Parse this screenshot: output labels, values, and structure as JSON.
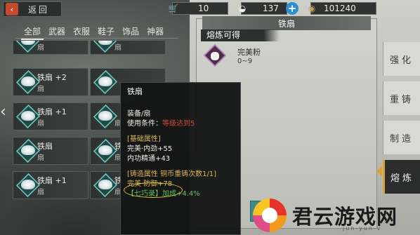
{
  "topbar": {
    "back_label": "返回",
    "resources": [
      {
        "icon": "cart-icon",
        "value": "10"
      },
      {
        "icon": "silver-ingot-icon",
        "value": "137"
      },
      {
        "icon": "coin-icon",
        "value": "101240"
      }
    ],
    "plus_label": "+"
  },
  "tabs": [
    "全部",
    "武器",
    "衣服",
    "鞋子",
    "饰品",
    "神器"
  ],
  "active_tab": "全部",
  "items": [
    {
      "name": "",
      "type": "扇"
    },
    {
      "name": "",
      "type": "扇"
    },
    {
      "name": "铁扇 +2",
      "type": "扇"
    },
    {
      "name": "",
      "type": ""
    },
    {
      "name": "铁扇 +1",
      "type": "扇"
    },
    {
      "name": "",
      "type": "扇"
    },
    {
      "name": "铁扇",
      "type": "扇"
    },
    {
      "name": "铁",
      "type": "扇"
    },
    {
      "name": "铁扇 +1",
      "type": "扇"
    },
    {
      "name": "铁",
      "type": "扇"
    }
  ],
  "tooltip": {
    "title": "铁扇",
    "equip_type": "装备/扇",
    "use_condition_label": "使用条件：",
    "use_condition_value": "等级达到5",
    "basic_header": "[基础属性]",
    "basic_attrs": [
      "完美·内劲+55",
      "内功精通+43"
    ],
    "forge_header": "[铸造属性 铜币重铸次数1/1]",
    "forge_attr": "完美·防御+78",
    "extra_attr": "【七巧录】加成+4.4%"
  },
  "right_panel": {
    "title": "铁扇",
    "smelt_label": "熔炼可得",
    "result_name": "完美粉",
    "result_range": "0~9"
  },
  "side_tabs": [
    "强化",
    "重铸",
    "制造",
    "熔炼"
  ],
  "active_side_tab": "熔炼",
  "watermark": {
    "text": "君云游戏网",
    "sub": "jun-yun-v"
  }
}
